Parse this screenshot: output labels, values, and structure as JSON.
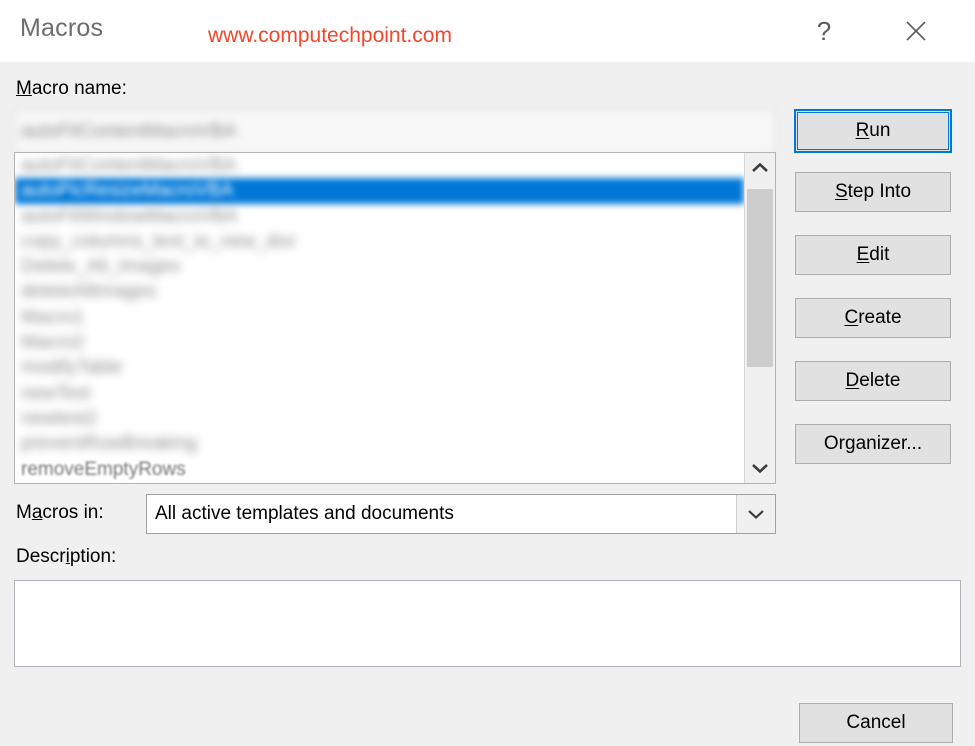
{
  "window": {
    "title": "Macros",
    "watermark": "www.computechpoint.com",
    "help_icon": "question-mark-icon",
    "close_icon": "close-icon"
  },
  "labels": {
    "macro_name": "Macro name:",
    "macro_name_accesskey": "M",
    "macros_in": "Macros in:",
    "macros_in_accesskey": "a",
    "description": "Description:",
    "description_accesskey": "i"
  },
  "macro_name_field": {
    "value": "autoFitContentMacroVBA",
    "placeholder": ""
  },
  "macro_list": {
    "selected_index": 1,
    "items": [
      "autoFitContentMacroVBA",
      "autoPicResizeMacroVBA",
      "autoFitWindowMacroVBA",
      "copy_columns_text_to_new_doc",
      "Delete_All_Images",
      "deleteAllImages",
      "Macro1",
      "Macro2",
      "modifyTable",
      "newTest",
      "newtest2",
      "preventRowBreaking",
      "removeEmptyRows"
    ],
    "scrollbar": {
      "up_icon": "chevron-up-icon",
      "down_icon": "chevron-down-icon"
    }
  },
  "macros_in_combo": {
    "value": "All active templates and documents",
    "arrow_icon": "chevron-down-icon"
  },
  "description_box": {
    "value": ""
  },
  "buttons": {
    "run": "Run",
    "run_accesskey": "R",
    "step_into": "Step Into",
    "step_into_accesskey": "S",
    "edit": "Edit",
    "edit_accesskey": "E",
    "create": "Create",
    "create_accesskey": "C",
    "delete": "Delete",
    "delete_accesskey": "D",
    "organizer": "Organizer...",
    "organizer_accesskey": "g",
    "cancel": "Cancel"
  },
  "colors": {
    "accent": "#0078d7",
    "watermark": "#f4462a",
    "dialog_bg": "#f0f0f0",
    "button_bg": "#e1e1e1"
  }
}
